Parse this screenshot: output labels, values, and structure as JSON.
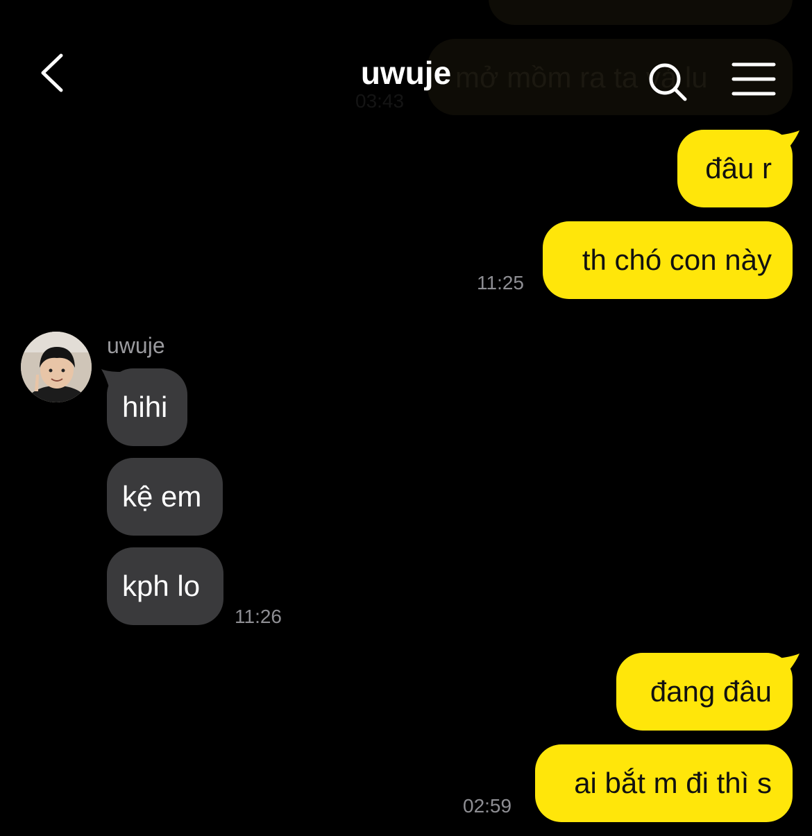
{
  "header": {
    "title": "uwuje",
    "back_icon": "chevron-left-icon",
    "search_icon": "search-icon",
    "menu_icon": "menu-icon"
  },
  "faded_background": {
    "message_text": "mở mồm ra ta vả lu",
    "time": "03:43"
  },
  "messages": {
    "m1": {
      "text": "đâu r"
    },
    "m2": {
      "text": "th chó con này"
    },
    "t1": "11:25",
    "sender_name": "uwuje",
    "m3": {
      "text": "hihi"
    },
    "m4": {
      "text": "kệ em"
    },
    "m5": {
      "text": "kph lo"
    },
    "t2": "11:26",
    "m6": {
      "text": "đang đâu"
    },
    "m7": {
      "text": "ai bắt m đi thì s"
    },
    "t3": "02:59"
  },
  "colors": {
    "outgoing_bubble": "#ffe60a",
    "incoming_bubble": "#3a3a3c",
    "background": "#000000",
    "timestamp": "#8e8e93"
  }
}
